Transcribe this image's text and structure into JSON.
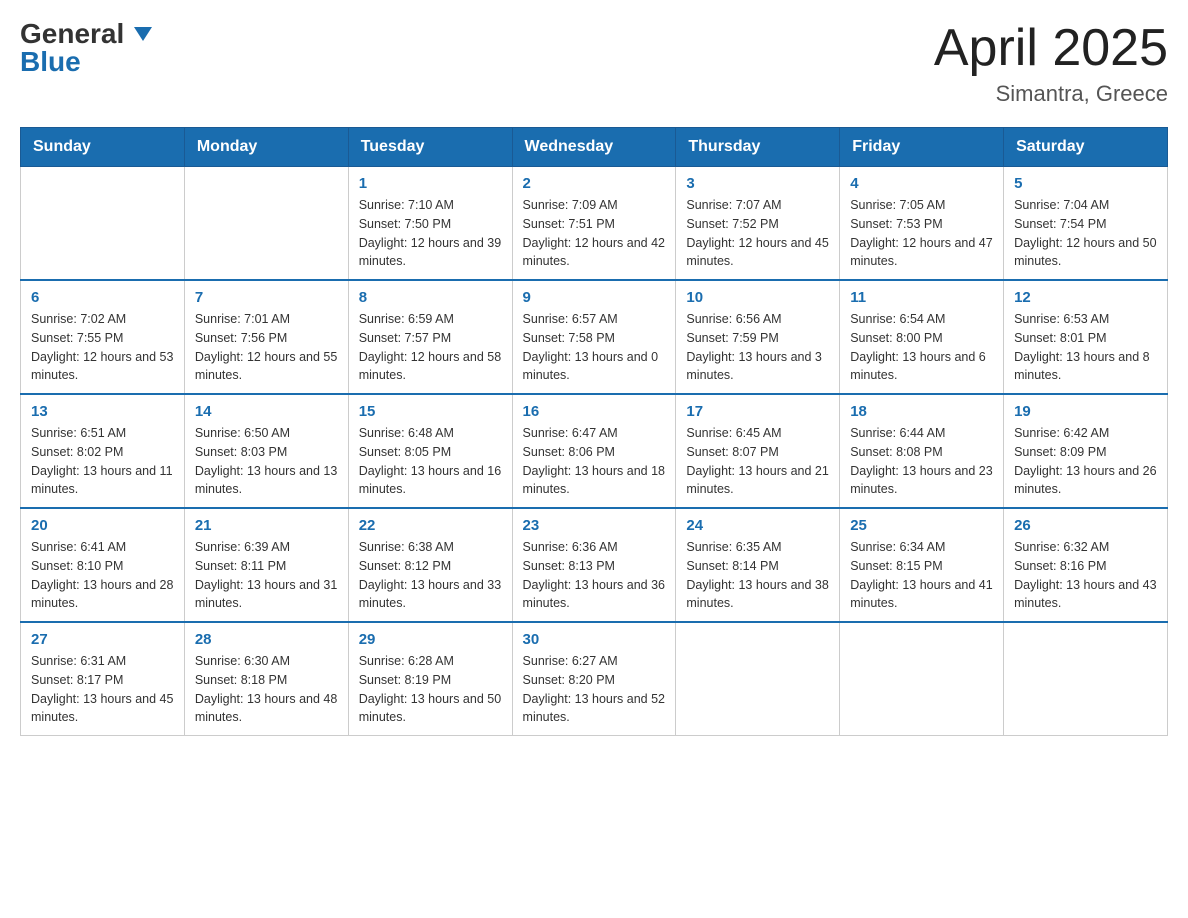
{
  "header": {
    "logo_general": "General",
    "logo_blue": "Blue",
    "month_title": "April 2025",
    "location": "Simantra, Greece"
  },
  "days_of_week": [
    "Sunday",
    "Monday",
    "Tuesday",
    "Wednesday",
    "Thursday",
    "Friday",
    "Saturday"
  ],
  "weeks": [
    [
      {
        "day": "",
        "sunrise": "",
        "sunset": "",
        "daylight": ""
      },
      {
        "day": "",
        "sunrise": "",
        "sunset": "",
        "daylight": ""
      },
      {
        "day": "1",
        "sunrise": "Sunrise: 7:10 AM",
        "sunset": "Sunset: 7:50 PM",
        "daylight": "Daylight: 12 hours and 39 minutes."
      },
      {
        "day": "2",
        "sunrise": "Sunrise: 7:09 AM",
        "sunset": "Sunset: 7:51 PM",
        "daylight": "Daylight: 12 hours and 42 minutes."
      },
      {
        "day": "3",
        "sunrise": "Sunrise: 7:07 AM",
        "sunset": "Sunset: 7:52 PM",
        "daylight": "Daylight: 12 hours and 45 minutes."
      },
      {
        "day": "4",
        "sunrise": "Sunrise: 7:05 AM",
        "sunset": "Sunset: 7:53 PM",
        "daylight": "Daylight: 12 hours and 47 minutes."
      },
      {
        "day": "5",
        "sunrise": "Sunrise: 7:04 AM",
        "sunset": "Sunset: 7:54 PM",
        "daylight": "Daylight: 12 hours and 50 minutes."
      }
    ],
    [
      {
        "day": "6",
        "sunrise": "Sunrise: 7:02 AM",
        "sunset": "Sunset: 7:55 PM",
        "daylight": "Daylight: 12 hours and 53 minutes."
      },
      {
        "day": "7",
        "sunrise": "Sunrise: 7:01 AM",
        "sunset": "Sunset: 7:56 PM",
        "daylight": "Daylight: 12 hours and 55 minutes."
      },
      {
        "day": "8",
        "sunrise": "Sunrise: 6:59 AM",
        "sunset": "Sunset: 7:57 PM",
        "daylight": "Daylight: 12 hours and 58 minutes."
      },
      {
        "day": "9",
        "sunrise": "Sunrise: 6:57 AM",
        "sunset": "Sunset: 7:58 PM",
        "daylight": "Daylight: 13 hours and 0 minutes."
      },
      {
        "day": "10",
        "sunrise": "Sunrise: 6:56 AM",
        "sunset": "Sunset: 7:59 PM",
        "daylight": "Daylight: 13 hours and 3 minutes."
      },
      {
        "day": "11",
        "sunrise": "Sunrise: 6:54 AM",
        "sunset": "Sunset: 8:00 PM",
        "daylight": "Daylight: 13 hours and 6 minutes."
      },
      {
        "day": "12",
        "sunrise": "Sunrise: 6:53 AM",
        "sunset": "Sunset: 8:01 PM",
        "daylight": "Daylight: 13 hours and 8 minutes."
      }
    ],
    [
      {
        "day": "13",
        "sunrise": "Sunrise: 6:51 AM",
        "sunset": "Sunset: 8:02 PM",
        "daylight": "Daylight: 13 hours and 11 minutes."
      },
      {
        "day": "14",
        "sunrise": "Sunrise: 6:50 AM",
        "sunset": "Sunset: 8:03 PM",
        "daylight": "Daylight: 13 hours and 13 minutes."
      },
      {
        "day": "15",
        "sunrise": "Sunrise: 6:48 AM",
        "sunset": "Sunset: 8:05 PM",
        "daylight": "Daylight: 13 hours and 16 minutes."
      },
      {
        "day": "16",
        "sunrise": "Sunrise: 6:47 AM",
        "sunset": "Sunset: 8:06 PM",
        "daylight": "Daylight: 13 hours and 18 minutes."
      },
      {
        "day": "17",
        "sunrise": "Sunrise: 6:45 AM",
        "sunset": "Sunset: 8:07 PM",
        "daylight": "Daylight: 13 hours and 21 minutes."
      },
      {
        "day": "18",
        "sunrise": "Sunrise: 6:44 AM",
        "sunset": "Sunset: 8:08 PM",
        "daylight": "Daylight: 13 hours and 23 minutes."
      },
      {
        "day": "19",
        "sunrise": "Sunrise: 6:42 AM",
        "sunset": "Sunset: 8:09 PM",
        "daylight": "Daylight: 13 hours and 26 minutes."
      }
    ],
    [
      {
        "day": "20",
        "sunrise": "Sunrise: 6:41 AM",
        "sunset": "Sunset: 8:10 PM",
        "daylight": "Daylight: 13 hours and 28 minutes."
      },
      {
        "day": "21",
        "sunrise": "Sunrise: 6:39 AM",
        "sunset": "Sunset: 8:11 PM",
        "daylight": "Daylight: 13 hours and 31 minutes."
      },
      {
        "day": "22",
        "sunrise": "Sunrise: 6:38 AM",
        "sunset": "Sunset: 8:12 PM",
        "daylight": "Daylight: 13 hours and 33 minutes."
      },
      {
        "day": "23",
        "sunrise": "Sunrise: 6:36 AM",
        "sunset": "Sunset: 8:13 PM",
        "daylight": "Daylight: 13 hours and 36 minutes."
      },
      {
        "day": "24",
        "sunrise": "Sunrise: 6:35 AM",
        "sunset": "Sunset: 8:14 PM",
        "daylight": "Daylight: 13 hours and 38 minutes."
      },
      {
        "day": "25",
        "sunrise": "Sunrise: 6:34 AM",
        "sunset": "Sunset: 8:15 PM",
        "daylight": "Daylight: 13 hours and 41 minutes."
      },
      {
        "day": "26",
        "sunrise": "Sunrise: 6:32 AM",
        "sunset": "Sunset: 8:16 PM",
        "daylight": "Daylight: 13 hours and 43 minutes."
      }
    ],
    [
      {
        "day": "27",
        "sunrise": "Sunrise: 6:31 AM",
        "sunset": "Sunset: 8:17 PM",
        "daylight": "Daylight: 13 hours and 45 minutes."
      },
      {
        "day": "28",
        "sunrise": "Sunrise: 6:30 AM",
        "sunset": "Sunset: 8:18 PM",
        "daylight": "Daylight: 13 hours and 48 minutes."
      },
      {
        "day": "29",
        "sunrise": "Sunrise: 6:28 AM",
        "sunset": "Sunset: 8:19 PM",
        "daylight": "Daylight: 13 hours and 50 minutes."
      },
      {
        "day": "30",
        "sunrise": "Sunrise: 6:27 AM",
        "sunset": "Sunset: 8:20 PM",
        "daylight": "Daylight: 13 hours and 52 minutes."
      },
      {
        "day": "",
        "sunrise": "",
        "sunset": "",
        "daylight": ""
      },
      {
        "day": "",
        "sunrise": "",
        "sunset": "",
        "daylight": ""
      },
      {
        "day": "",
        "sunrise": "",
        "sunset": "",
        "daylight": ""
      }
    ]
  ]
}
